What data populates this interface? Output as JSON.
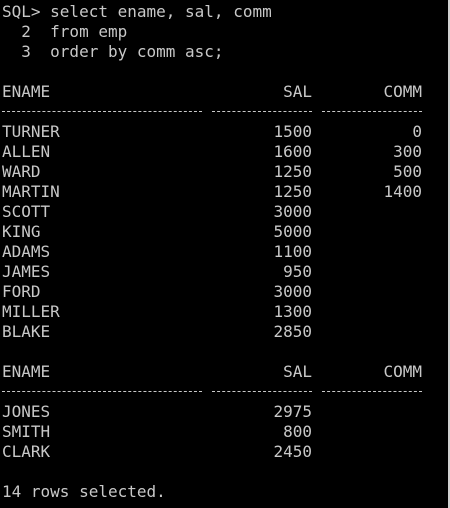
{
  "query": {
    "prompt": "SQL>",
    "lines": [
      "SQL> select ename, sal, comm",
      "  2  from emp",
      "  3  order by comm asc;"
    ]
  },
  "columns": {
    "ename": "ENAME",
    "sal": "SAL",
    "comm": "COMM"
  },
  "pages": [
    {
      "rows": [
        {
          "ename": "TURNER",
          "sal": "1500",
          "comm": "0"
        },
        {
          "ename": "ALLEN",
          "sal": "1600",
          "comm": "300"
        },
        {
          "ename": "WARD",
          "sal": "1250",
          "comm": "500"
        },
        {
          "ename": "MARTIN",
          "sal": "1250",
          "comm": "1400"
        },
        {
          "ename": "SCOTT",
          "sal": "3000",
          "comm": ""
        },
        {
          "ename": "KING",
          "sal": "5000",
          "comm": ""
        },
        {
          "ename": "ADAMS",
          "sal": "1100",
          "comm": ""
        },
        {
          "ename": "JAMES",
          "sal": "950",
          "comm": ""
        },
        {
          "ename": "FORD",
          "sal": "3000",
          "comm": ""
        },
        {
          "ename": "MILLER",
          "sal": "1300",
          "comm": ""
        },
        {
          "ename": "BLAKE",
          "sal": "2850",
          "comm": ""
        }
      ]
    },
    {
      "rows": [
        {
          "ename": "JONES",
          "sal": "2975",
          "comm": ""
        },
        {
          "ename": "SMITH",
          "sal": "800",
          "comm": ""
        },
        {
          "ename": "CLARK",
          "sal": "2450",
          "comm": ""
        }
      ]
    }
  ],
  "footer": "14 rows selected.",
  "colors": {
    "background": "#000000",
    "text": "#c8c8c8"
  }
}
